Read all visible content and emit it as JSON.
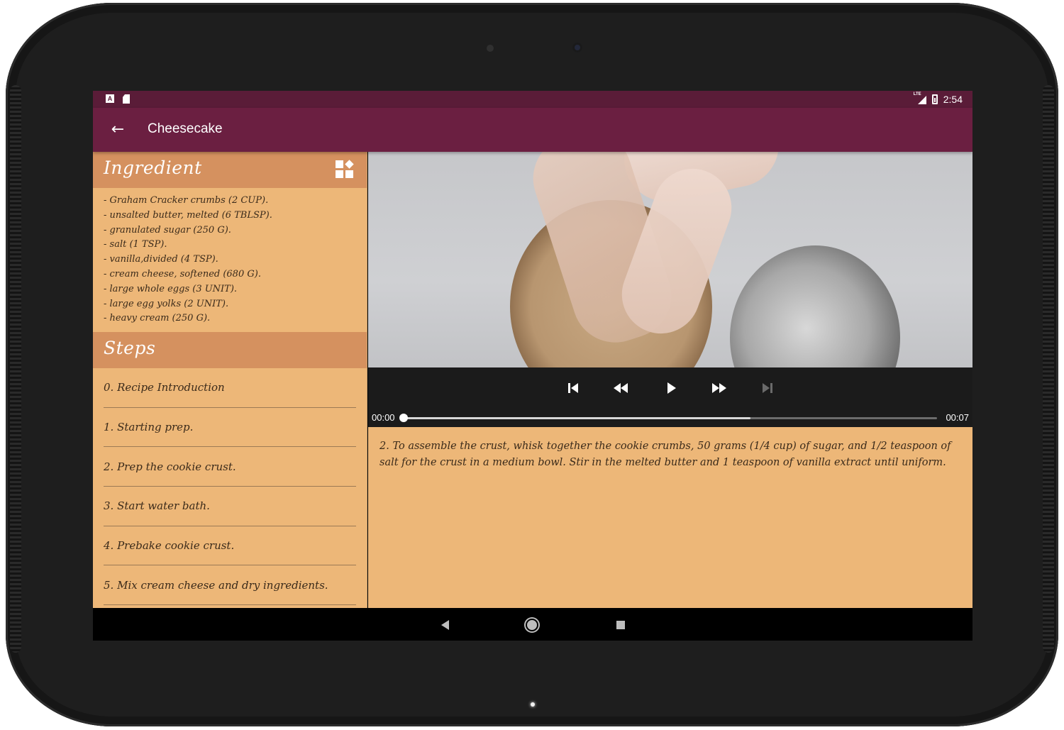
{
  "status_bar": {
    "left_icons": [
      "a-keyboard-icon",
      "sd-card-icon"
    ],
    "network": "LTE",
    "time": "2:54"
  },
  "app_bar": {
    "title": "Cheesecake",
    "back_icon": "arrow-left-icon",
    "color": "#6b1f41"
  },
  "ingredients": {
    "header": "Ingredient",
    "widget_icon": "add-widget-icon",
    "items": [
      "- Graham Cracker crumbs (2 CUP).",
      "- unsalted butter, melted (6 TBLSP).",
      "- granulated sugar (250 G).",
      "- salt (1 TSP).",
      "- vanilla,divided (4 TSP).",
      "- cream cheese, softened (680 G).",
      "- large whole eggs (3 UNIT).",
      "- large egg yolks (2 UNIT).",
      "- heavy cream (250 G)."
    ]
  },
  "steps": {
    "header": "Steps",
    "items": [
      "0. Recipe Introduction",
      "1. Starting prep.",
      "2. Prep the cookie crust.",
      "3. Start water bath.",
      "4. Prebake cookie crust.",
      "5. Mix cream cheese and dry ingredients."
    ]
  },
  "player": {
    "current_time": "00:00",
    "duration": "00:07",
    "buffered_fraction": 0.65,
    "played_fraction": 0.0,
    "controls": {
      "previous": "skip-previous-icon",
      "rewind": "rewind-icon",
      "play": "play-icon",
      "fast_forward": "fast-forward-icon",
      "next": "skip-next-icon"
    }
  },
  "description": "2. To assemble the crust, whisk together the cookie crumbs, 50 grams (1/4 cup) of sugar, and 1/2 teaspoon of salt for the crust in a medium bowl. Stir in the melted butter and 1 teaspoon of vanilla extract until uniform.",
  "colors": {
    "status_bar": "#5a1c38",
    "panel_bg": "#edb778",
    "section_header": "#d5915f"
  }
}
